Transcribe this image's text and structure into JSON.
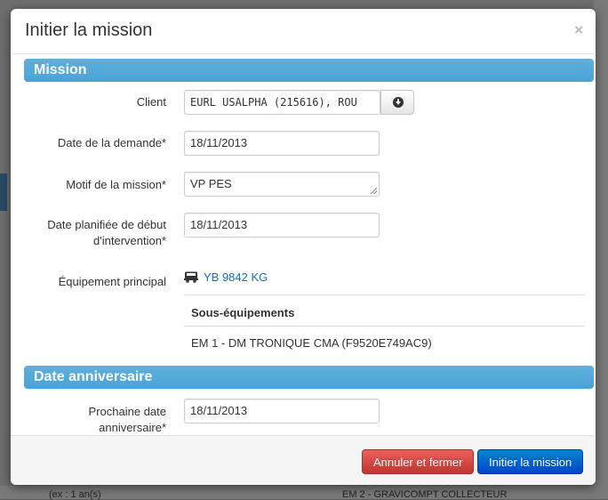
{
  "modal": {
    "title": "Initier la mission",
    "close": "×"
  },
  "sections": {
    "mission": "Mission",
    "anniversary": "Date anniversaire"
  },
  "fields": {
    "client": {
      "label": "Client",
      "value": "EURL USALPHA (215616), ROU"
    },
    "request_date": {
      "label": "Date de la demande*",
      "value": "18/11/2013"
    },
    "reason": {
      "label": "Motif de la mission*",
      "value": "VP PES"
    },
    "planned_start": {
      "label_line1": "Date planifiée de début",
      "label_line2": "d'intervention*",
      "value": "18/11/2013"
    },
    "main_equipment": {
      "label": "Équipement principal",
      "value": "YB 9842 KG",
      "icon": "truck-icon"
    },
    "next_anniversary": {
      "label_line1": "Prochaine date",
      "label_line2": "anniversaire*",
      "value": "18/11/2013"
    }
  },
  "sub_equipment": {
    "header": "Sous-équipements",
    "rows": [
      "EM 1 - DM TRONIQUE CMA (F9520E749AC9)"
    ]
  },
  "footer": {
    "cancel_label": "Annuler et fermer",
    "submit_label": "Initier la mission"
  },
  "background": {
    "bottom_left": "(ex : 1 an(s)",
    "bottom_right": "EM 2 - GRAVICOMPT COLLECTEUR"
  },
  "colors": {
    "section_bar": "#4aa3d6",
    "link": "#0f6fc6",
    "danger": "#bd362f",
    "primary": "#0044cc"
  }
}
